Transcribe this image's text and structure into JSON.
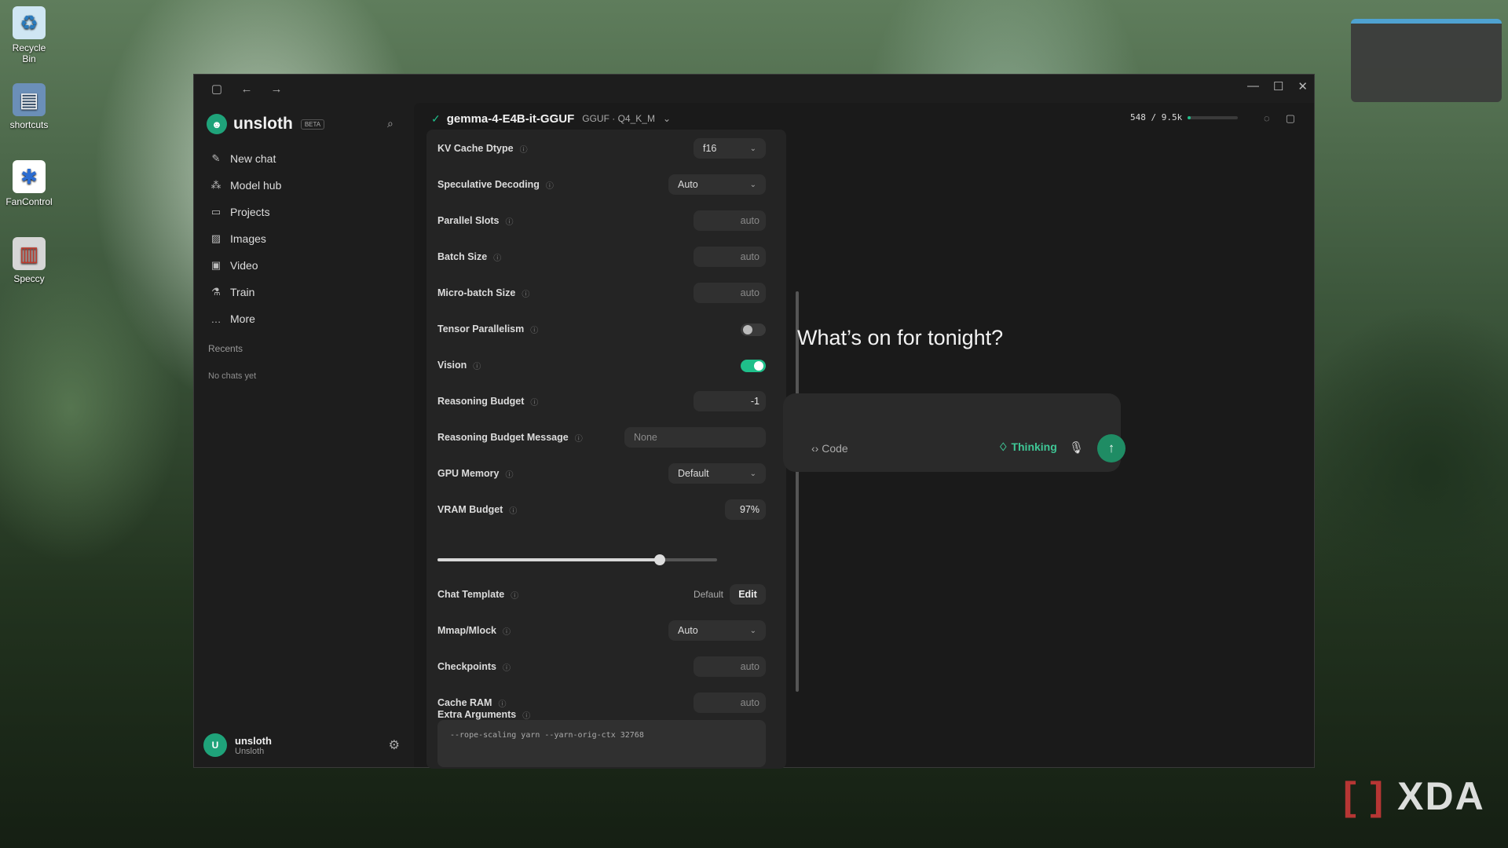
{
  "desktop": {
    "icons": [
      {
        "label": "Recycle Bin",
        "icon": "recycle-bin-icon"
      },
      {
        "label": "shortcuts",
        "icon": "folder-icon"
      },
      {
        "label": "FanControl",
        "icon": "fan-icon"
      },
      {
        "label": "Speccy",
        "icon": "speccy-icon"
      }
    ],
    "watermark": "XDA"
  },
  "app": {
    "brand": "unsloth",
    "beta_badge": "BETA",
    "nav": [
      {
        "label": "New chat",
        "icon": "edit-icon"
      },
      {
        "label": "Model hub",
        "icon": "hub-icon"
      },
      {
        "label": "Projects",
        "icon": "folder-icon"
      },
      {
        "label": "Images",
        "icon": "image-icon"
      },
      {
        "label": "Video",
        "icon": "video-icon"
      },
      {
        "label": "Train",
        "icon": "flask-icon"
      },
      {
        "label": "More",
        "icon": "more-icon"
      }
    ],
    "recents_label": "Recents",
    "no_chats": "No chats yet",
    "user": {
      "avatar": "U",
      "name": "unsloth",
      "org": "Unsloth"
    }
  },
  "topbar": {
    "model": "gemma-4-E4B-it-GGUF",
    "meta": "GGUF · Q4_K_M",
    "context": "548 / 9.5k",
    "context_fraction": 0.057
  },
  "settings": {
    "rows": [
      {
        "label": "KV Cache Dtype",
        "type": "select",
        "value": "f16"
      },
      {
        "label": "Speculative Decoding",
        "type": "select",
        "value": "Auto"
      },
      {
        "label": "Parallel Slots",
        "type": "number",
        "value": "auto"
      },
      {
        "label": "Batch Size",
        "type": "number",
        "value": "auto"
      },
      {
        "label": "Micro-batch Size",
        "type": "number",
        "value": "auto"
      },
      {
        "label": "Tensor Parallelism",
        "type": "toggle",
        "on": false
      },
      {
        "label": "Vision",
        "type": "toggle",
        "on": true
      },
      {
        "label": "Reasoning Budget",
        "type": "number",
        "value": "-1"
      },
      {
        "label": "Reasoning Budget Message",
        "type": "text",
        "value": "None"
      },
      {
        "label": "GPU Memory",
        "type": "select",
        "value": "Default"
      },
      {
        "label": "VRAM Budget",
        "type": "number",
        "value": "97%"
      },
      {
        "label": "Chat Template",
        "type": "template",
        "value": "Default",
        "button": "Edit"
      },
      {
        "label": "Mmap/Mlock",
        "type": "select",
        "value": "Auto"
      },
      {
        "label": "Checkpoints",
        "type": "number",
        "value": "auto"
      },
      {
        "label": "Cache RAM",
        "type": "number",
        "value": "auto"
      }
    ],
    "vram_fraction": 0.97,
    "extra_label": "Extra Arguments",
    "extra_value": "--rope-scaling yarn --yarn-orig-ctx 32768"
  },
  "chat": {
    "greeting": "What’s on for tonight?",
    "code_label": "Code",
    "thinking_label": "Thinking"
  }
}
